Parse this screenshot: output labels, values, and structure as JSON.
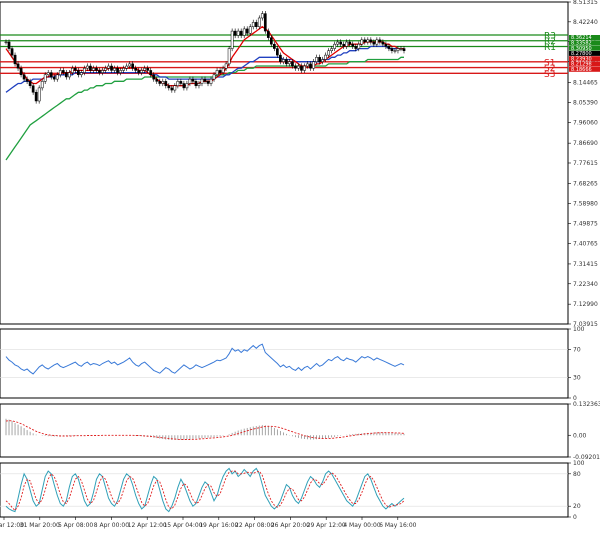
{
  "colors": {
    "candle": "#000000",
    "ma_fast": "#e00000",
    "ma_mid": "#2040c0",
    "ma_slow": "#20a040",
    "resistance": "#1a8a1a",
    "support": "#d81818",
    "pivot_line": "#a06060",
    "rsi": "#3a7ad8",
    "macd_signal": "#e02020",
    "macd_hist": "#909090",
    "stoch_k": "#30a0b8",
    "stoch_d": "#e02020",
    "grid": "#dddddd"
  },
  "chart_data": [
    {
      "type": "candlestick",
      "panel": "price",
      "ylim": [
        7.03915,
        8.51315
      ],
      "y_ticks": [
        "8.51315",
        "8.42240",
        "8.33165",
        "8.24090",
        "8.14465",
        "8.05390",
        "7.96060",
        "7.86690",
        "7.77615",
        "7.68265",
        "7.58980",
        "7.49875",
        "7.40765",
        "7.31415",
        "7.22340",
        "7.12990",
        "7.03915"
      ],
      "x_ticks": [
        "28 Mar 12:00",
        "31 Mar 20:00",
        "5 Apr 08:00",
        "8 Apr 00:00",
        "12 Apr 12:00",
        "15 Apr 04:00",
        "19 Apr 16:00",
        "22 Apr 08:00",
        "26 Apr 20:00",
        "29 Apr 12:00",
        "4 May 00:00",
        "6 May 16:00"
      ],
      "closes": [
        8.33,
        8.3,
        8.27,
        8.23,
        8.21,
        8.18,
        8.16,
        8.15,
        8.13,
        8.1,
        8.06,
        8.12,
        8.15,
        8.18,
        8.19,
        8.17,
        8.16,
        8.18,
        8.2,
        8.19,
        8.17,
        8.19,
        8.21,
        8.2,
        8.18,
        8.19,
        8.21,
        8.22,
        8.2,
        8.21,
        8.2,
        8.19,
        8.2,
        8.21,
        8.22,
        8.2,
        8.21,
        8.19,
        8.2,
        8.21,
        8.22,
        8.23,
        8.21,
        8.2,
        8.19,
        8.2,
        8.21,
        8.2,
        8.18,
        8.16,
        8.15,
        8.14,
        8.15,
        8.13,
        8.12,
        8.11,
        8.13,
        8.15,
        8.14,
        8.12,
        8.14,
        8.16,
        8.15,
        8.13,
        8.14,
        8.16,
        8.15,
        8.14,
        8.16,
        8.18,
        8.2,
        8.19,
        8.21,
        8.23,
        8.3,
        8.38,
        8.36,
        8.38,
        8.36,
        8.39,
        8.37,
        8.4,
        8.42,
        8.4,
        8.44,
        8.46,
        8.38,
        8.35,
        8.32,
        8.3,
        8.27,
        8.24,
        8.25,
        8.23,
        8.24,
        8.22,
        8.21,
        8.22,
        8.2,
        8.22,
        8.23,
        8.21,
        8.24,
        8.26,
        8.24,
        8.25,
        8.27,
        8.29,
        8.3,
        8.32,
        8.33,
        8.32,
        8.31,
        8.33,
        8.32,
        8.31,
        8.3,
        8.32,
        8.34,
        8.33,
        8.34,
        8.33,
        8.32,
        8.34,
        8.33,
        8.32,
        8.31,
        8.3,
        8.29,
        8.29,
        8.3,
        8.3,
        8.29
      ],
      "ma_fast": [
        8.3,
        8.28,
        8.26,
        8.24,
        8.22,
        8.2,
        8.18,
        8.16,
        8.15,
        8.14,
        8.14,
        8.15,
        8.16,
        8.17,
        8.17,
        8.18,
        8.18,
        8.18,
        8.19,
        8.19,
        8.19,
        8.19,
        8.2,
        8.2,
        8.2,
        8.2,
        8.2,
        8.2,
        8.2,
        8.2,
        8.2,
        8.2,
        8.2,
        8.2,
        8.21,
        8.21,
        8.21,
        8.21,
        8.21,
        8.21,
        8.21,
        8.21,
        8.21,
        8.21,
        8.2,
        8.2,
        8.2,
        8.19,
        8.18,
        8.17,
        8.16,
        8.15,
        8.14,
        8.14,
        8.13,
        8.13,
        8.13,
        8.13,
        8.13,
        8.13,
        8.13,
        8.14,
        8.14,
        8.14,
        8.14,
        8.15,
        8.15,
        8.15,
        8.15,
        8.16,
        8.17,
        8.18,
        8.19,
        8.21,
        8.23,
        8.26,
        8.28,
        8.3,
        8.32,
        8.34,
        8.35,
        8.36,
        8.37,
        8.38,
        8.39,
        8.4,
        8.39,
        8.38,
        8.36,
        8.34,
        8.32,
        8.3,
        8.28,
        8.27,
        8.26,
        8.25,
        8.24,
        8.23,
        8.22,
        8.22,
        8.22,
        8.22,
        8.22,
        8.23,
        8.23,
        8.24,
        8.25,
        8.26,
        8.27,
        8.28,
        8.29,
        8.3,
        8.31,
        8.31,
        8.32,
        8.32,
        8.32,
        8.32,
        8.32,
        8.33,
        8.33,
        8.33,
        8.33,
        8.33,
        8.33,
        8.33,
        8.32,
        8.32,
        8.31,
        8.31,
        8.3,
        8.3,
        8.3
      ],
      "ma_mid": [
        8.1,
        8.11,
        8.12,
        8.13,
        8.14,
        8.14,
        8.15,
        8.15,
        8.15,
        8.16,
        8.16,
        8.16,
        8.16,
        8.17,
        8.17,
        8.17,
        8.17,
        8.18,
        8.18,
        8.18,
        8.18,
        8.18,
        8.18,
        8.19,
        8.19,
        8.19,
        8.19,
        8.19,
        8.19,
        8.19,
        8.19,
        8.19,
        8.19,
        8.19,
        8.19,
        8.19,
        8.19,
        8.19,
        8.19,
        8.19,
        8.19,
        8.19,
        8.19,
        8.19,
        8.19,
        8.19,
        8.19,
        8.19,
        8.18,
        8.18,
        8.18,
        8.17,
        8.17,
        8.17,
        8.16,
        8.16,
        8.16,
        8.16,
        8.16,
        8.16,
        8.16,
        8.16,
        8.16,
        8.16,
        8.16,
        8.16,
        8.16,
        8.16,
        8.16,
        8.16,
        8.17,
        8.17,
        8.17,
        8.18,
        8.18,
        8.19,
        8.2,
        8.21,
        8.21,
        8.22,
        8.23,
        8.24,
        8.24,
        8.25,
        8.26,
        8.26,
        8.26,
        8.26,
        8.26,
        8.26,
        8.26,
        8.26,
        8.25,
        8.25,
        8.25,
        8.25,
        8.24,
        8.24,
        8.24,
        8.24,
        8.24,
        8.24,
        8.24,
        8.24,
        8.24,
        8.25,
        8.25,
        8.25,
        8.26,
        8.26,
        8.27,
        8.27,
        8.28,
        8.28,
        8.29,
        8.29,
        8.29,
        8.3,
        8.3,
        8.3,
        8.3,
        8.31,
        8.31,
        8.31,
        8.31,
        8.31,
        8.31,
        8.3,
        8.3,
        8.3,
        8.3,
        8.3,
        8.3
      ],
      "ma_slow": [
        7.79,
        7.81,
        7.83,
        7.85,
        7.87,
        7.89,
        7.91,
        7.93,
        7.95,
        7.96,
        7.97,
        7.98,
        7.99,
        8.0,
        8.01,
        8.02,
        8.03,
        8.04,
        8.05,
        8.06,
        8.07,
        8.07,
        8.08,
        8.09,
        8.1,
        8.1,
        8.11,
        8.11,
        8.12,
        8.12,
        8.13,
        8.13,
        8.13,
        8.14,
        8.14,
        8.14,
        8.15,
        8.15,
        8.15,
        8.15,
        8.16,
        8.16,
        8.16,
        8.16,
        8.16,
        8.16,
        8.17,
        8.17,
        8.17,
        8.17,
        8.17,
        8.17,
        8.17,
        8.17,
        8.17,
        8.17,
        8.17,
        8.17,
        8.17,
        8.17,
        8.17,
        8.17,
        8.17,
        8.17,
        8.17,
        8.17,
        8.17,
        8.17,
        8.17,
        8.17,
        8.18,
        8.18,
        8.18,
        8.18,
        8.19,
        8.19,
        8.19,
        8.2,
        8.2,
        8.2,
        8.21,
        8.21,
        8.21,
        8.22,
        8.22,
        8.22,
        8.22,
        8.22,
        8.22,
        8.22,
        8.22,
        8.22,
        8.22,
        8.22,
        8.22,
        8.22,
        8.22,
        8.22,
        8.22,
        8.22,
        8.22,
        8.22,
        8.22,
        8.22,
        8.22,
        8.22,
        8.22,
        8.23,
        8.23,
        8.23,
        8.23,
        8.23,
        8.23,
        8.23,
        8.24,
        8.24,
        8.24,
        8.24,
        8.24,
        8.24,
        8.25,
        8.25,
        8.25,
        8.25,
        8.25,
        8.25,
        8.25,
        8.25,
        8.25,
        8.25,
        8.25,
        8.26,
        8.26
      ],
      "pivot_levels": [
        {
          "label": "R3",
          "value": 8.36214,
          "kind": "resistance"
        },
        {
          "label": "R2",
          "value": 8.33582,
          "kind": "resistance"
        },
        {
          "label": "R1",
          "value": 8.3095,
          "kind": "resistance"
        },
        {
          "label": "S1",
          "value": 8.2393,
          "kind": "support"
        },
        {
          "label": "S2",
          "value": 8.21298,
          "kind": "support"
        },
        {
          "label": "S3",
          "value": 8.18666,
          "kind": "support"
        }
      ],
      "pivot_badges": [
        "8.36214",
        "8.33582",
        "8.30950",
        "8.27800",
        "8.23930",
        "8.21298",
        "8.18666"
      ],
      "current_price": "8.27800"
    },
    {
      "type": "line",
      "panel": "rsi",
      "ylim": [
        0,
        100
      ],
      "y_ticks": [
        "100",
        "70",
        "30",
        "0"
      ],
      "values": [
        60,
        55,
        52,
        48,
        46,
        42,
        40,
        42,
        38,
        35,
        40,
        45,
        48,
        44,
        42,
        45,
        48,
        50,
        46,
        44,
        46,
        48,
        50,
        52,
        48,
        46,
        50,
        52,
        48,
        50,
        49,
        47,
        50,
        52,
        54,
        50,
        52,
        48,
        50,
        52,
        55,
        58,
        52,
        48,
        46,
        50,
        52,
        48,
        44,
        40,
        38,
        36,
        40,
        44,
        42,
        38,
        36,
        40,
        44,
        48,
        45,
        42,
        44,
        48,
        46,
        44,
        46,
        48,
        50,
        52,
        55,
        54,
        56,
        58,
        64,
        72,
        68,
        70,
        66,
        70,
        68,
        72,
        76,
        72,
        76,
        78,
        66,
        62,
        58,
        54,
        50,
        45,
        48,
        44,
        46,
        42,
        40,
        44,
        40,
        44,
        46,
        42,
        46,
        50,
        46,
        48,
        52,
        56,
        54,
        58,
        60,
        56,
        54,
        58,
        56,
        55,
        52,
        56,
        60,
        58,
        60,
        58,
        55,
        58,
        56,
        54,
        52,
        50,
        48,
        46,
        48,
        50,
        48
      ],
      "levels": [
        70,
        30
      ]
    },
    {
      "type": "bar+line",
      "panel": "macd",
      "ylim": [
        -0.092012,
        0.132363
      ],
      "y_ticks": [
        "0.132363",
        "0.00",
        "-0.092012"
      ],
      "histogram": [
        0.07,
        0.066,
        0.06,
        0.052,
        0.045,
        0.038,
        0.03,
        0.022,
        0.015,
        0.008,
        0.003,
        0.0,
        -0.002,
        -0.003,
        -0.004,
        -0.004,
        -0.005,
        -0.005,
        -0.004,
        -0.004,
        -0.003,
        -0.003,
        -0.002,
        -0.002,
        -0.002,
        -0.001,
        -0.001,
        -0.001,
        -0.001,
        0.0,
        0.0,
        0.0,
        0.0,
        0.0,
        0.0,
        0.0,
        0.0,
        0.0,
        0.0,
        0.0,
        0.0,
        0.0,
        -0.001,
        -0.002,
        -0.003,
        -0.004,
        -0.005,
        -0.006,
        -0.008,
        -0.01,
        -0.012,
        -0.014,
        -0.016,
        -0.018,
        -0.019,
        -0.02,
        -0.02,
        -0.02,
        -0.019,
        -0.018,
        -0.017,
        -0.016,
        -0.015,
        -0.014,
        -0.013,
        -0.012,
        -0.011,
        -0.01,
        -0.009,
        -0.008,
        -0.006,
        -0.004,
        -0.002,
        0.0,
        0.004,
        0.01,
        0.015,
        0.02,
        0.024,
        0.028,
        0.031,
        0.034,
        0.037,
        0.039,
        0.041,
        0.043,
        0.042,
        0.04,
        0.036,
        0.031,
        0.025,
        0.018,
        0.012,
        0.006,
        0.001,
        -0.004,
        -0.008,
        -0.011,
        -0.014,
        -0.016,
        -0.017,
        -0.018,
        -0.018,
        -0.017,
        -0.016,
        -0.015,
        -0.013,
        -0.011,
        -0.009,
        -0.007,
        -0.004,
        -0.002,
        0.0,
        0.002,
        0.003,
        0.005,
        0.006,
        0.007,
        0.008,
        0.009,
        0.01,
        0.011,
        0.012,
        0.012,
        0.012,
        0.012,
        0.012,
        0.011,
        0.01,
        0.009,
        0.008,
        0.007,
        0.006
      ],
      "signal": [
        0.06,
        0.062,
        0.061,
        0.058,
        0.054,
        0.049,
        0.043,
        0.036,
        0.03,
        0.023,
        0.017,
        0.012,
        0.008,
        0.004,
        0.002,
        0.0,
        -0.001,
        -0.002,
        -0.003,
        -0.003,
        -0.003,
        -0.003,
        -0.003,
        -0.002,
        -0.002,
        -0.002,
        -0.002,
        -0.001,
        -0.001,
        -0.001,
        -0.001,
        -0.001,
        0.0,
        0.0,
        0.0,
        0.0,
        0.0,
        0.0,
        0.0,
        0.0,
        0.0,
        0.0,
        0.0,
        -0.001,
        -0.001,
        -0.002,
        -0.003,
        -0.004,
        -0.005,
        -0.006,
        -0.008,
        -0.009,
        -0.011,
        -0.012,
        -0.014,
        -0.015,
        -0.016,
        -0.017,
        -0.018,
        -0.018,
        -0.018,
        -0.018,
        -0.017,
        -0.017,
        -0.016,
        -0.015,
        -0.014,
        -0.013,
        -0.012,
        -0.011,
        -0.01,
        -0.008,
        -0.007,
        -0.005,
        -0.003,
        0.0,
        0.003,
        0.007,
        0.011,
        0.015,
        0.019,
        0.023,
        0.026,
        0.029,
        0.032,
        0.035,
        0.037,
        0.038,
        0.038,
        0.037,
        0.035,
        0.032,
        0.028,
        0.024,
        0.019,
        0.015,
        0.01,
        0.006,
        0.002,
        -0.002,
        -0.005,
        -0.008,
        -0.01,
        -0.012,
        -0.013,
        -0.014,
        -0.014,
        -0.014,
        -0.013,
        -0.012,
        -0.01,
        -0.009,
        -0.007,
        -0.005,
        -0.003,
        -0.001,
        0.001,
        0.003,
        0.004,
        0.006,
        0.007,
        0.008,
        0.009,
        0.01,
        0.011,
        0.011,
        0.011,
        0.011,
        0.011,
        0.01,
        0.01,
        0.009,
        0.008
      ]
    },
    {
      "type": "line",
      "panel": "stochastic",
      "ylim": [
        0,
        100
      ],
      "y_ticks": [
        "100",
        "80",
        "20",
        "0"
      ],
      "k": [
        20,
        15,
        12,
        10,
        35,
        60,
        80,
        70,
        50,
        30,
        20,
        25,
        50,
        75,
        85,
        80,
        60,
        40,
        25,
        20,
        30,
        55,
        75,
        80,
        70,
        50,
        30,
        20,
        25,
        45,
        70,
        80,
        75,
        55,
        35,
        25,
        20,
        30,
        50,
        70,
        80,
        75,
        60,
        40,
        25,
        15,
        20,
        40,
        60,
        75,
        70,
        50,
        30,
        15,
        10,
        20,
        35,
        55,
        70,
        60,
        45,
        30,
        20,
        25,
        40,
        55,
        65,
        60,
        45,
        30,
        40,
        60,
        75,
        85,
        90,
        80,
        85,
        75,
        80,
        88,
        82,
        75,
        85,
        90,
        80,
        60,
        40,
        30,
        20,
        15,
        20,
        30,
        45,
        60,
        55,
        40,
        30,
        25,
        35,
        50,
        65,
        75,
        70,
        60,
        55,
        65,
        80,
        85,
        80,
        70,
        60,
        50,
        40,
        30,
        25,
        20,
        30,
        45,
        60,
        75,
        80,
        70,
        55,
        40,
        30,
        20,
        15,
        20,
        25,
        20,
        25,
        30,
        35
      ],
      "d": [
        30,
        25,
        18,
        12,
        20,
        35,
        58,
        70,
        67,
        50,
        33,
        25,
        32,
        50,
        70,
        80,
        75,
        60,
        42,
        28,
        25,
        35,
        53,
        70,
        75,
        67,
        50,
        33,
        25,
        30,
        47,
        65,
        75,
        70,
        55,
        38,
        27,
        25,
        33,
        50,
        67,
        75,
        72,
        58,
        42,
        27,
        20,
        25,
        40,
        58,
        68,
        65,
        50,
        32,
        18,
        15,
        22,
        37,
        53,
        62,
        58,
        45,
        32,
        25,
        28,
        40,
        53,
        60,
        57,
        45,
        38,
        43,
        58,
        73,
        83,
        85,
        85,
        80,
        80,
        81,
        83,
        82,
        81,
        83,
        85,
        77,
        60,
        43,
        30,
        22,
        18,
        22,
        32,
        45,
        53,
        52,
        42,
        32,
        30,
        37,
        50,
        63,
        70,
        68,
        62,
        60,
        67,
        77,
        82,
        78,
        70,
        60,
        50,
        40,
        32,
        25,
        25,
        32,
        45,
        60,
        72,
        75,
        68,
        55,
        42,
        30,
        22,
        18,
        20,
        22,
        23,
        25,
        30
      ]
    }
  ]
}
